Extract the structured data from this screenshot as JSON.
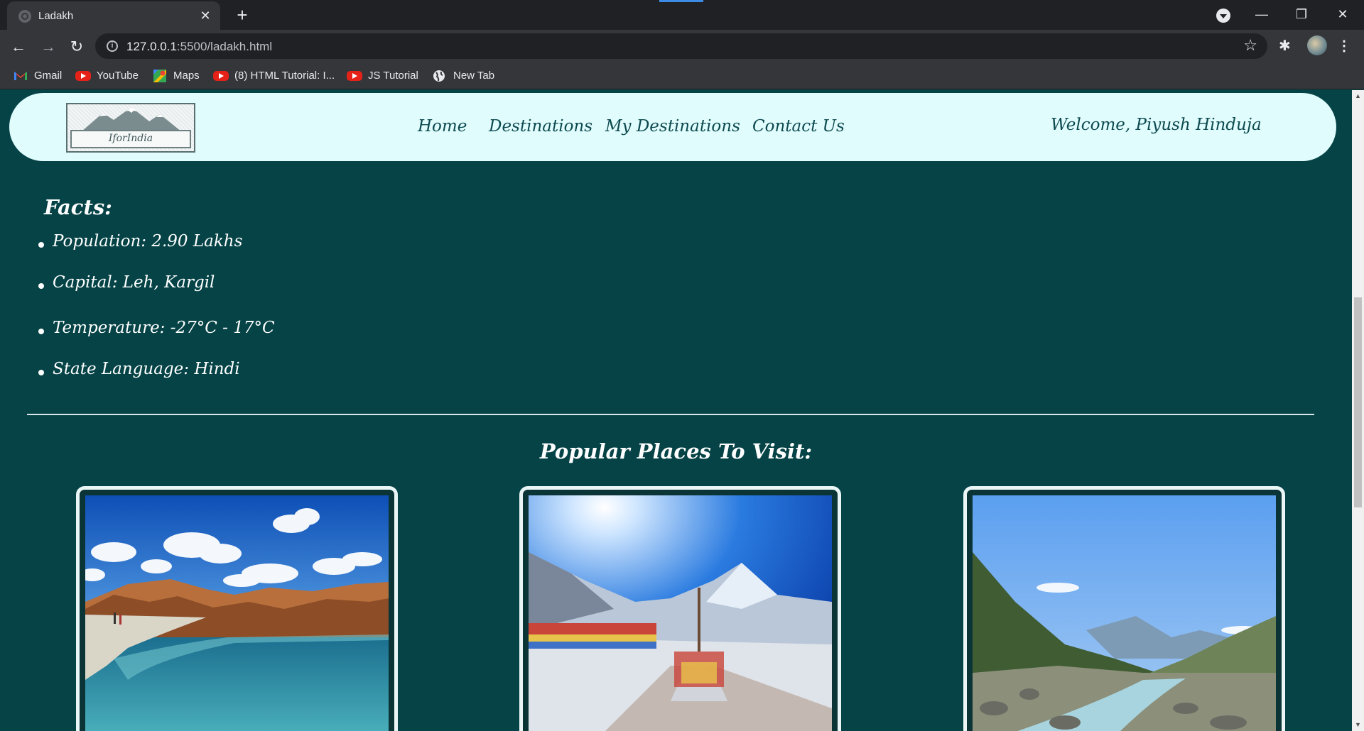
{
  "browser": {
    "tab_title": "Ladakh",
    "url_host": "127.0.0.1",
    "url_path": ":5500/ladakh.html",
    "bookmarks": [
      "Gmail",
      "YouTube",
      "Maps",
      "(8) HTML Tutorial: I...",
      "JS Tutorial",
      "New Tab"
    ]
  },
  "site": {
    "logo_text": "IforIndia",
    "nav": [
      "Home",
      "Destinations",
      "My Destinations",
      "Contact Us"
    ],
    "welcome": "Welcome, Piyush Hinduja"
  },
  "facts": {
    "title": "Facts:",
    "items": [
      "Population: 2.90 Lakhs",
      "Capital: Leh, Kargil",
      "Temperature: -27°C - 17°C",
      "State Language: Hindi"
    ]
  },
  "places": {
    "title": "Popular Places To Visit:",
    "cards": [
      {
        "image": "lake-mountains-photo"
      },
      {
        "image": "prayer-flags-snow-pass-photo"
      },
      {
        "image": "river-valley-photo"
      }
    ]
  }
}
